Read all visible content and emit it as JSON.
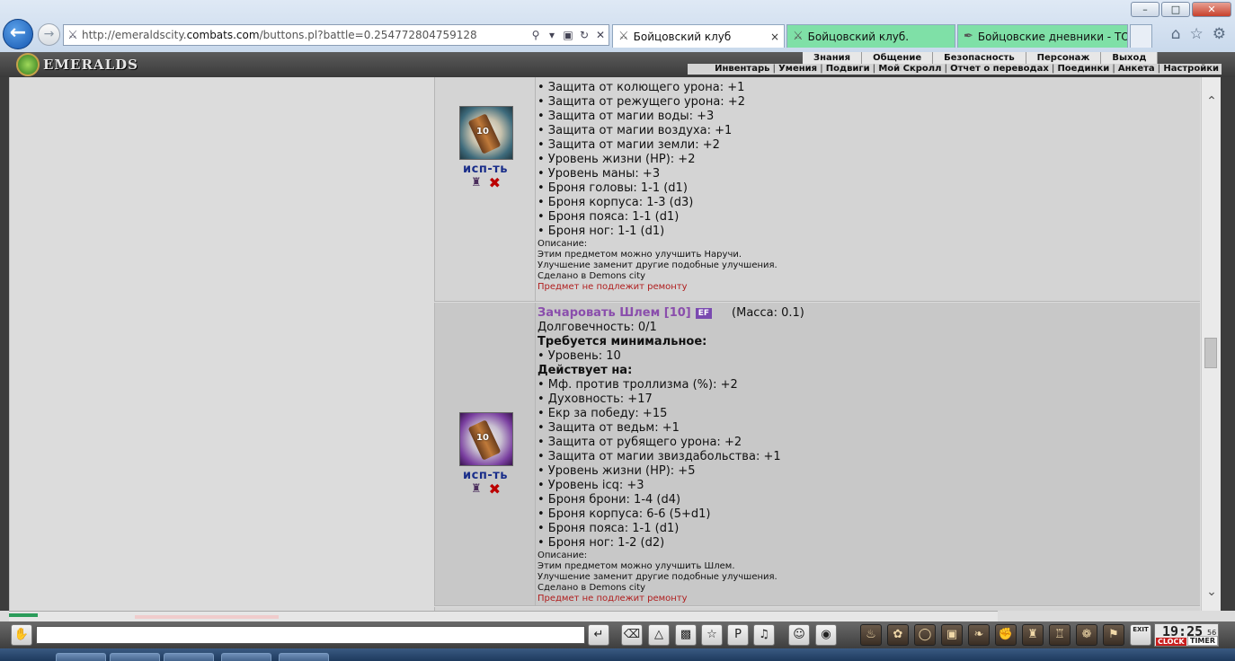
{
  "window": {
    "minimize": "–",
    "maximize": "□",
    "close": "✕"
  },
  "browser": {
    "url_prefix": "http://emeraldscity.",
    "url_domain": "combats.com",
    "url_suffix": "/buttons.pl?battle=0.254772804759128",
    "tabs": [
      {
        "label": "Бойцовский клуб",
        "close": "×"
      },
      {
        "label": "Бойцовский клуб."
      },
      {
        "label": "Бойцовские дневники - ТО..."
      }
    ]
  },
  "game": {
    "logo": "EMERALDS",
    "menu_top": [
      "Знания",
      "Общение",
      "Безопасность",
      "Персонаж",
      "Выход"
    ],
    "menu_sub": [
      "Инвентарь",
      "Умения",
      "Подвиги",
      "Мой Скролл",
      "Отчет о переводах",
      "Поединки",
      "Анкета",
      "Настройки"
    ]
  },
  "items": [
    {
      "use_label": "исп-ть",
      "icon_number": "10",
      "lines": [
        "• Защита от колющего урона: +1",
        "• Защита от режущего урона: +2",
        "• Защита от магии воды: +3",
        "• Защита от магии воздуха: +1",
        "• Защита от магии земли: +2",
        "• Уровень жизни (HP): +2",
        "• Уровень маны: +3",
        "• Броня головы: 1-1 (d1)",
        "• Броня корпуса: 1-3 (d3)",
        "• Броня пояса: 1-1 (d1)",
        "• Броня ног: 1-1 (d1)"
      ],
      "desc_label": "Описание:",
      "desc": [
        "Этим предметом можно улучшить Наручи.",
        "Улучшение заменит другие подобные улучшения.",
        "Сделано в Demons city"
      ],
      "no_repair": "Предмет не подлежит ремонту"
    },
    {
      "title": "Зачаровать Шлем [10]",
      "badge": "EF",
      "mass": "(Масса: 0.1)",
      "use_label": "исп-ть",
      "icon_number": "10",
      "durability": "Долговечность: 0/1",
      "req_heading": "Требуется минимальное:",
      "req_level": "• Уровень: 10",
      "acts_heading": "Действует на:",
      "lines": [
        "• Мф. против троллизма (%): +2",
        "• Духовность: +17",
        "• Екр за победу: +15",
        "• Защита от ведьм: +1",
        "• Защита от рубящего урона: +2",
        "• Защита от магии звиздабольства: +1",
        "• Уровень жизни (HP): +5",
        "• Уровень icq: +3",
        "• Броня брони: 1-4 (d4)",
        "• Броня корпуса: 6-6 (5+d1)",
        "• Броня пояса: 1-1 (d1)",
        "• Броня ног: 1-2 (d2)"
      ],
      "desc_label": "Описание:",
      "desc": [
        "Этим предметом можно улучшить Шлем.",
        "Улучшение заменит другие подобные улучшения.",
        "Сделано в Demons city"
      ],
      "no_repair": "Предмет не подлежит ремонту"
    }
  ],
  "clock": {
    "time": "19:25",
    "seconds": "56",
    "clock_label": "CLOCK",
    "timer_label": "TIMER"
  },
  "toolbar": {
    "exit_label": "EXIT"
  },
  "colors": {
    "item_title": "#8a4eac",
    "use_link": "#1a2e8a",
    "no_repair": "#b01e1e",
    "tab_active_green": "#7fe0a7"
  }
}
